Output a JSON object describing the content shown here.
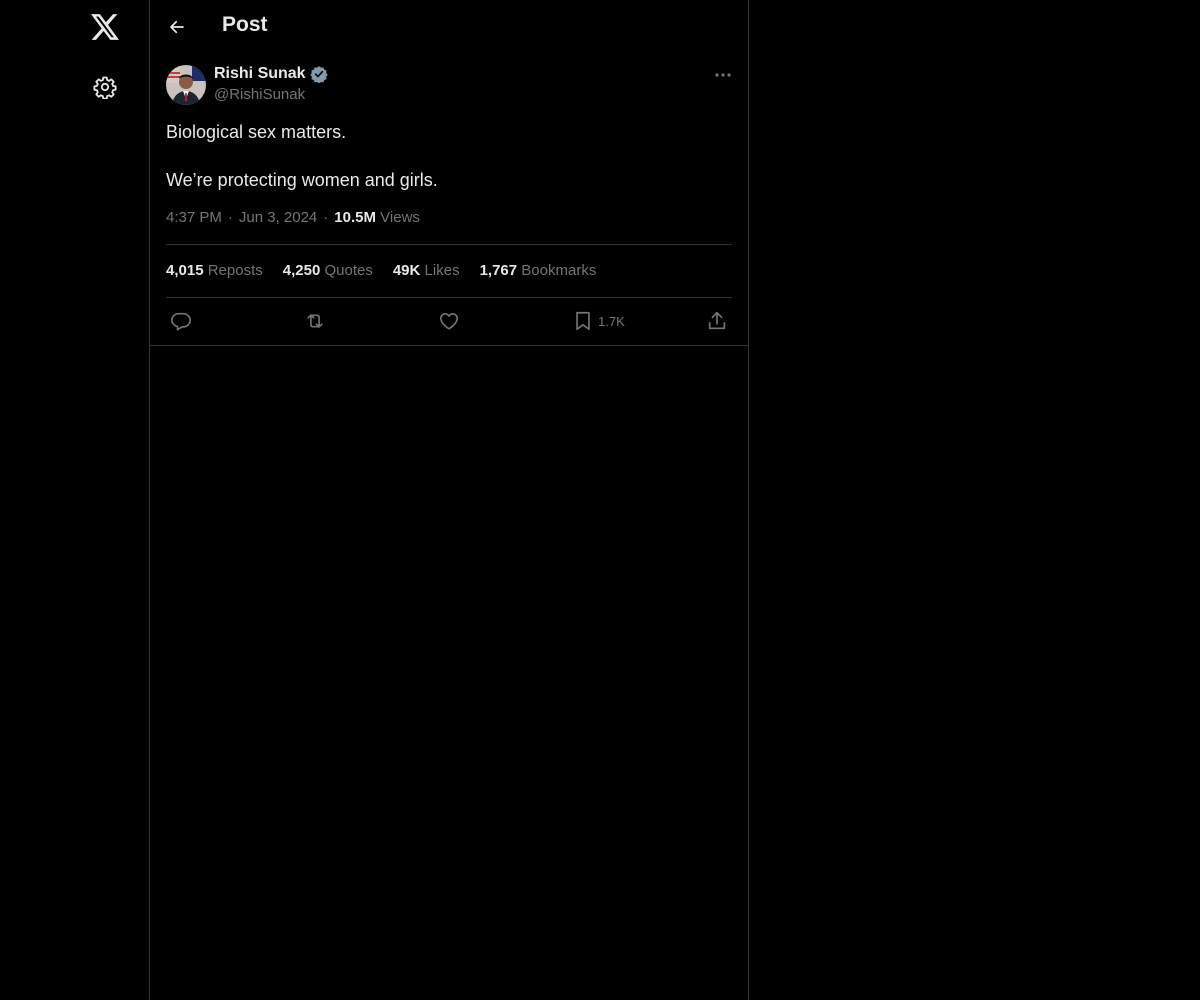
{
  "header": {
    "title": "Post"
  },
  "post": {
    "author_name": "Rishi Sunak",
    "author_handle": "@RishiSunak",
    "lines": [
      "Biological sex matters.",
      "We’re protecting women and girls."
    ],
    "time": "4:37 PM",
    "date": "Jun 3, 2024",
    "views_count": "10.5M",
    "views_label": "Views",
    "separator": "·"
  },
  "stats": {
    "reposts_count": "4,015",
    "reposts_label": "Reposts",
    "quotes_count": "4,250",
    "quotes_label": "Quotes",
    "likes_count": "49K",
    "likes_label": "Likes",
    "bookmarks_count": "1,767",
    "bookmarks_label": "Bookmarks"
  },
  "actions": {
    "bookmark_count": "1.7K"
  },
  "icons": {
    "logo": "x-logo-icon",
    "settings": "gear-icon",
    "back": "arrow-left-icon",
    "verified": "verified-badge-icon",
    "more": "more-horizontal-icon",
    "reply": "reply-icon",
    "repost": "repost-icon",
    "like": "heart-icon",
    "bookmark": "bookmark-icon",
    "share": "share-icon"
  },
  "colors": {
    "background": "#000000",
    "text": "#e7e9ea",
    "muted": "#71767b",
    "border": "#2f3336"
  }
}
